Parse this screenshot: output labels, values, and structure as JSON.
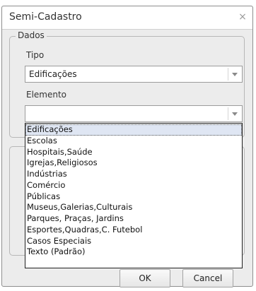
{
  "window": {
    "title": "Semi-Cadastro",
    "close_glyph": "×"
  },
  "group": {
    "legend": "Dados"
  },
  "tipo": {
    "label": "Tipo",
    "value": "Edificações"
  },
  "elemento": {
    "label": "Elemento",
    "value": ""
  },
  "dropdown": {
    "options": [
      "Edificações",
      "Escolas",
      "Hospitais,Saúde",
      "Igrejas,Religiosos",
      "Indústrias",
      "Comércio",
      "Públicas",
      "Museus,Galerias,Culturais",
      "Parques, Praças, Jardins",
      "Esportes,Quadras,C. Futebol",
      "Casos Especiais",
      "Texto (Padrão)"
    ],
    "selected_index": 0
  },
  "buttons": {
    "ok": "OK",
    "cancel": "Cancel"
  },
  "icons": {
    "close": "close-icon",
    "dropdown_arrow": "chevron-down-icon"
  }
}
